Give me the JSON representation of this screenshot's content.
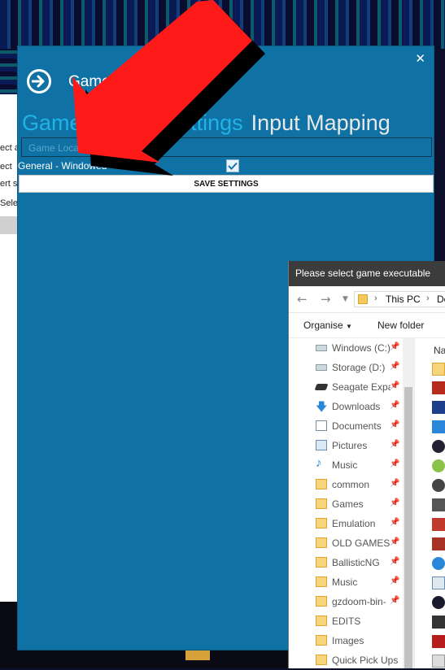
{
  "window": {
    "title": "Game Settings",
    "close_glyph": "✕"
  },
  "tabs": [
    {
      "label": "Game specific settings",
      "active": true
    },
    {
      "label": "Input Mapping",
      "active": false
    }
  ],
  "game_location": {
    "placeholder": "Game Location",
    "value": ""
  },
  "settings_rows": [
    {
      "label": "General - Windowed",
      "checked": true
    }
  ],
  "save_button": {
    "label": "SAVE SETTINGS"
  },
  "background_window": {
    "lines": [
      "ect a",
      "ect",
      "ert s",
      "Sele"
    ]
  },
  "file_dialog": {
    "title": "Please select game executable",
    "address": {
      "root": "This PC",
      "current": "De"
    },
    "toolbar": {
      "organise": "Organise",
      "new_folder": "New folder"
    },
    "column_header": "Na",
    "nav_items": [
      {
        "label": "Windows (C:)",
        "icon": "drive-icon"
      },
      {
        "label": "Storage (D:)",
        "icon": "drive-icon"
      },
      {
        "label": "Seagate Expan",
        "icon": "external-drive-icon"
      },
      {
        "label": "Downloads",
        "icon": "download-icon"
      },
      {
        "label": "Documents",
        "icon": "document-icon"
      },
      {
        "label": "Pictures",
        "icon": "pictures-icon"
      },
      {
        "label": "Music",
        "icon": "music-icon"
      },
      {
        "label": "common",
        "icon": "folder-icon"
      },
      {
        "label": "Games",
        "icon": "folder-icon"
      },
      {
        "label": "Emulation",
        "icon": "folder-icon"
      },
      {
        "label": "OLD GAMES",
        "icon": "folder-icon"
      },
      {
        "label": "BallisticNG",
        "icon": "folder-icon"
      },
      {
        "label": "Music",
        "icon": "folder-icon"
      },
      {
        "label": "gzdoom-bin-",
        "icon": "folder-icon"
      },
      {
        "label": "EDITS",
        "icon": "folder-icon"
      },
      {
        "label": "Images",
        "icon": "folder-icon"
      },
      {
        "label": "Quick Pick Ups",
        "icon": "folder-icon"
      }
    ]
  },
  "colors": {
    "panel": "#0f71a4",
    "tab_active": "#1fb3e6",
    "arrow": "#ff1a1a"
  }
}
